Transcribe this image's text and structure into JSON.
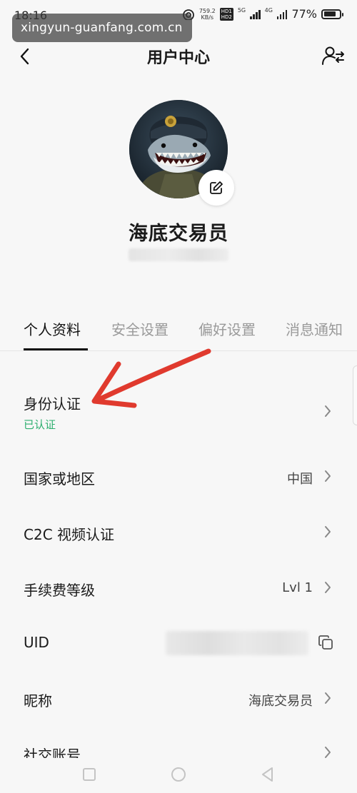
{
  "status_bar": {
    "time": "18:16",
    "net_speed_value": "759.2",
    "net_speed_unit": "KB/s",
    "hd1": "HD1",
    "hd2": "HD2",
    "sig1_label": "5G",
    "sig2_label": "4G",
    "battery_pct": "77%",
    "battery_level": 0.77
  },
  "watermark": {
    "text": "xingyun-guanfang.com.cn"
  },
  "header": {
    "title": "用户中心"
  },
  "profile": {
    "nickname": "海底交易员"
  },
  "tabs": [
    {
      "label": "个人资料",
      "active": true
    },
    {
      "label": "安全设置",
      "active": false
    },
    {
      "label": "偏好设置",
      "active": false
    },
    {
      "label": "消息通知",
      "active": false
    }
  ],
  "rows": {
    "identity": {
      "label": "身份认证",
      "status": "已认证"
    },
    "country": {
      "label": "国家或地区",
      "value": "中国"
    },
    "c2c_video": {
      "label": "C2C 视频认证"
    },
    "fee_level": {
      "label": "手续费等级",
      "value": "Lvl 1"
    },
    "uid": {
      "label": "UID"
    },
    "nickname": {
      "label": "昵称",
      "value": "海底交易员"
    },
    "social": {
      "label": "社交账号"
    }
  },
  "colors": {
    "verified_green": "#2cae6e",
    "annotation_red": "#e03a2e",
    "background": "#f7f7f7"
  }
}
